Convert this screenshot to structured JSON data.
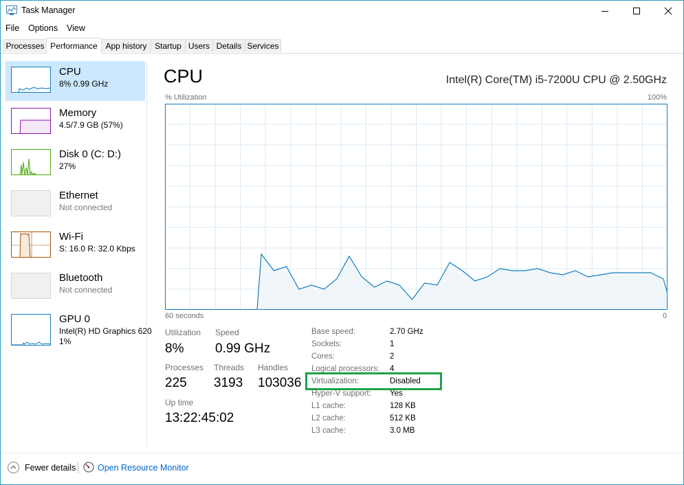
{
  "window": {
    "title": "Task Manager"
  },
  "menu": [
    "File",
    "Options",
    "View"
  ],
  "tabs": [
    "Processes",
    "Performance",
    "App history",
    "Startup",
    "Users",
    "Details",
    "Services"
  ],
  "sidebar": [
    {
      "title": "CPU",
      "sub": "8%  0.99 GHz",
      "sub2": ""
    },
    {
      "title": "Memory",
      "sub": "4.5/7.9 GB (57%)",
      "sub2": ""
    },
    {
      "title": "Disk 0 (C: D:)",
      "sub": "27%",
      "sub2": ""
    },
    {
      "title": "Ethernet",
      "sub": "Not connected",
      "sub2": ""
    },
    {
      "title": "Wi-Fi",
      "sub": "S: 16.0  R: 32.0 Kbps",
      "sub2": ""
    },
    {
      "title": "Bluetooth",
      "sub": "Not connected",
      "sub2": ""
    },
    {
      "title": "GPU 0",
      "sub": "Intel(R) HD Graphics 620",
      "sub2": "1%"
    }
  ],
  "main": {
    "title": "CPU",
    "model": "Intel(R) Core(TM) i5-7200U CPU @ 2.50GHz",
    "util_label": "% Utilization",
    "max_label": "100%",
    "time_label": "60 seconds",
    "min_label": "0"
  },
  "stats": {
    "utilization_label": "Utilization",
    "utilization": "8%",
    "speed_label": "Speed",
    "speed": "0.99 GHz",
    "processes_label": "Processes",
    "processes": "225",
    "threads_label": "Threads",
    "threads": "3193",
    "handles_label": "Handles",
    "handles": "103036",
    "uptime_label": "Up time",
    "uptime": "13:22:45:02"
  },
  "props": [
    {
      "label": "Base speed:",
      "value": "2.70 GHz"
    },
    {
      "label": "Sockets:",
      "value": "1"
    },
    {
      "label": "Cores:",
      "value": "2"
    },
    {
      "label": "Logical processors:",
      "value": "4"
    },
    {
      "label": "Virtualization:",
      "value": "Disabled"
    },
    {
      "label": "Hyper-V support:",
      "value": "Yes"
    },
    {
      "label": "L1 cache:",
      "value": "128 KB"
    },
    {
      "label": "L2 cache:",
      "value": "512 KB"
    },
    {
      "label": "L3 cache:",
      "value": "3.0 MB"
    }
  ],
  "footer": {
    "fewer": "Fewer details",
    "monitor": "Open Resource Monitor"
  },
  "chart_data": {
    "type": "area",
    "x_unit": "seconds",
    "xlim": [
      60,
      0
    ],
    "ylim": [
      0,
      100
    ],
    "grid": true,
    "x": [
      60,
      49,
      48.5,
      47,
      45.5,
      44,
      42.5,
      41,
      39.5,
      38,
      36.5,
      35,
      33.5,
      32,
      30.5,
      29,
      27.5,
      26,
      24.5,
      23,
      21.5,
      20,
      18.5,
      17,
      15.5,
      14,
      12.5,
      11,
      9.5,
      8,
      6.5,
      5,
      3.5,
      2,
      0.5,
      0
    ],
    "values": [
      0,
      0,
      27,
      19,
      21,
      10,
      12,
      10,
      15,
      26,
      16,
      11,
      14,
      12,
      5,
      13,
      12,
      23,
      19,
      14,
      16,
      20,
      19,
      19,
      20,
      18,
      17,
      19,
      16,
      17,
      18,
      18,
      18,
      18,
      15,
      8
    ]
  },
  "colors": {
    "accent": "#117dbb",
    "cpu_fill": "#f1f6fa",
    "grid": "#d9eaf4",
    "memory": "#8b12ae",
    "disk": "#4da60c",
    "wifi": "#a74f01",
    "highlight": "#1fa24a",
    "link": "#0066cc"
  }
}
